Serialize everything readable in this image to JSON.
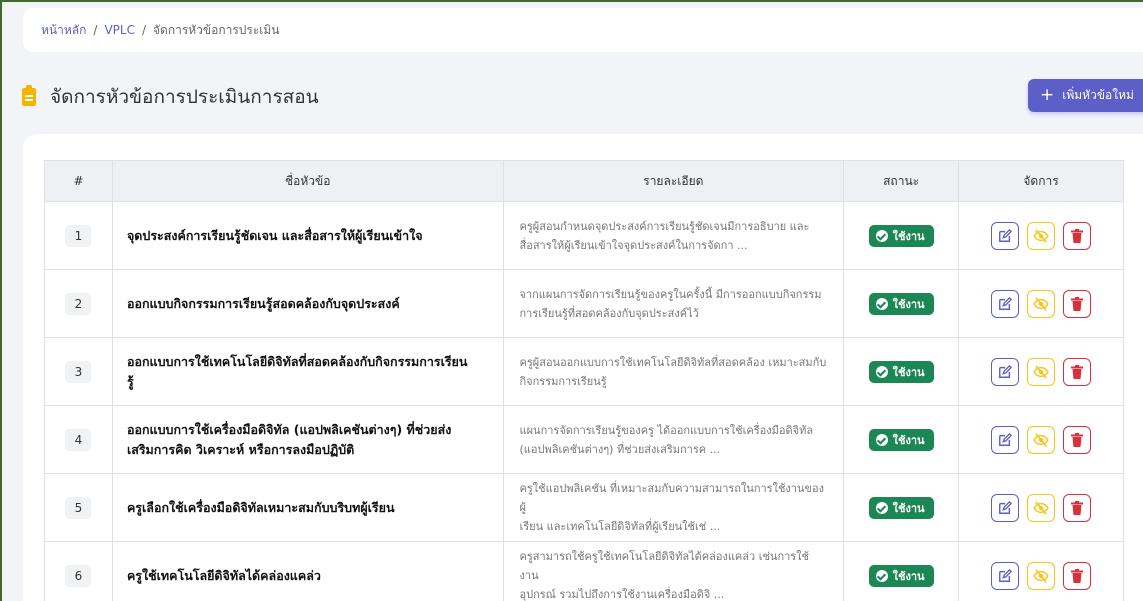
{
  "breadcrumb": {
    "home": "หน้าหลัก",
    "section": "VPLC",
    "current": "จัดการหัวข้อการประเมิน",
    "separator": "/"
  },
  "header": {
    "title": "จัดการหัวข้อการประเมินการสอน",
    "icon": "clipboard-icon",
    "add_button_label": "เพิ่มหัวข้อใหม่"
  },
  "table": {
    "columns": [
      "#",
      "ชื่อหัวข้อ",
      "รายละเอียด",
      "สถานะ",
      "จัดการ"
    ],
    "rows": [
      {
        "num": "1",
        "title": "จุดประสงค์การเรียนรู้ชัดเจน และสื่อสารให้ผู้เรียนเข้าใจ",
        "desc_line1": "ครูผู้สอนกำหนดจุดประสงค์การเรียนรู้ชัดเจนมีการอธิบาย และ",
        "desc_line2": "สื่อสารให้ผู้เรียนเข้าใจจุดประสงค์ในการจัดกา ...",
        "status": "ใช้งาน"
      },
      {
        "num": "2",
        "title": "ออกแบบกิจกรรมการเรียนรู้สอดคล้องกับจุดประสงค์",
        "desc_line1": "จากแผนการจัดการเรียนรู้ของครูในครั้งนี้ มีการออกแบบกิจกรรม",
        "desc_line2": "การเรียนรู้ที่สอดคล้องกับจุดประสงค์ไว้",
        "status": "ใช้งาน"
      },
      {
        "num": "3",
        "title_line1": "ออกแบบการใช้เทคโนโลยีดิจิทัลที่สอดคล้องกับกิจกรรมการเรียน",
        "title_line2": "รู้",
        "desc_line1": "ครูผู้สอนออกแบบการใช้เทคโนโลยีดิจิทัลที่สอดคล้อง เหมาะสมกับ",
        "desc_line2": "กิจกรรมการเรียนรู้",
        "status": "ใช้งาน"
      },
      {
        "num": "4",
        "title_line1": "ออกแบบการใช้เครื่องมือดิจิทัล (แอปพลิเคชันต่างๆ) ที่ช่วยส่ง",
        "title_line2": "เสริมการคิด วิเคราะห์ หรือการลงมือปฏิบัติ",
        "desc_line1": "แผนการจัดการเรียนรู้ของครู ได้ออกแบบการใช้เครื่องมือดิจิทัล",
        "desc_line2": "(แอปพลิเคชันต่างๆ) ที่ช่วยส่งเสริมการค ...",
        "status": "ใช้งาน"
      },
      {
        "num": "5",
        "title": "ครูเลือกใช้เครื่องมือดิจิทัลเหมาะสมกับบริบทผู้เรียน",
        "desc_line1": "ครูใช้แอปพลิเคชัน ที่เหมาะสมกับความสามารถในการใช้งานของผู้",
        "desc_line2": "เรียน และเทคโนโลยีดิจิทัลที่ผู้เรียนใช้เช่ ...",
        "status": "ใช้งาน"
      },
      {
        "num": "6",
        "title": "ครูใช้เทคโนโลยีดิจิทัลได้คล่องแคล่ว",
        "desc_line1": "ครูสามารถใช้ครูใช้เทคโนโลยีดิจิทัลได้คล่องแคล่ว เช่นการใช้งาน",
        "desc_line2": "อุปกรณ์ รวมไปถึงการใช้งานเครื่องมือดิจิ ...",
        "status": "ใช้งาน"
      }
    ]
  },
  "colors": {
    "accent": "#5b5fc7",
    "status_active": "#1a8754",
    "warning": "#f5c518",
    "danger": "#d9313c"
  }
}
